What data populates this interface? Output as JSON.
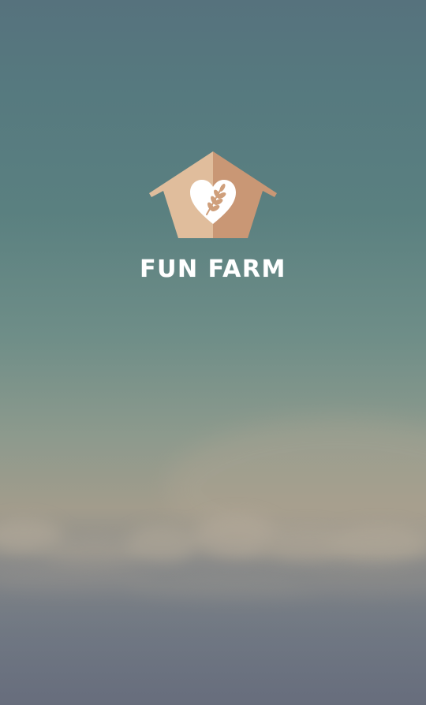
{
  "app": {
    "title": "FUN FARM"
  },
  "logo": {
    "icon": "house-heart-wheat-icon",
    "colors": {
      "roof_light": "#e0bd9c",
      "roof_dark": "#c99775",
      "heart": "#ffffff"
    }
  },
  "background": {
    "icon": "cloudy-sky-backdrop",
    "colors": {
      "sky_top": "#56727d",
      "sky_mid": "#5a8080",
      "horizon": "#a29c8c",
      "bottom": "#6a7180"
    }
  }
}
